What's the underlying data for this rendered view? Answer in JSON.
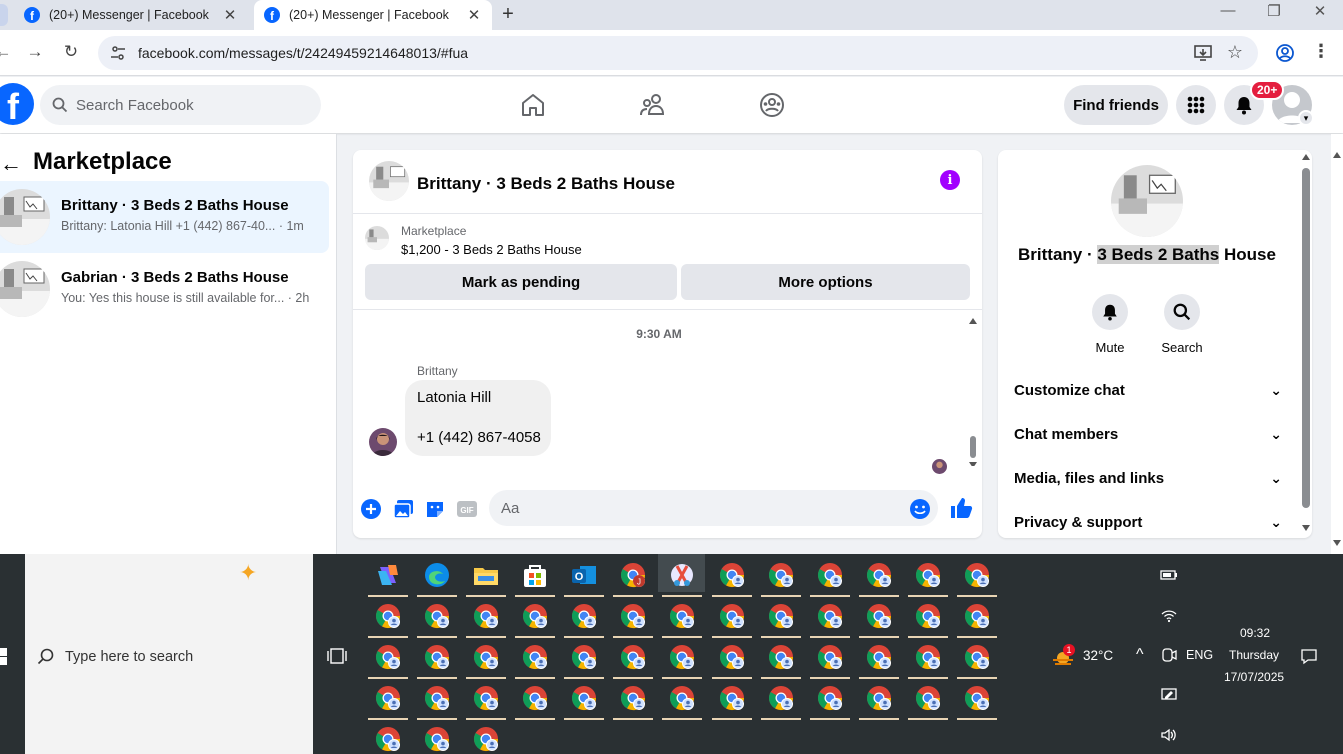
{
  "browser": {
    "tabs": [
      {
        "title": "(20+) Messenger | Facebook",
        "active": false
      },
      {
        "title": "(20+) Messenger | Facebook",
        "active": true
      }
    ],
    "new_tab_label": "+",
    "url": "facebook.com/messages/t/24249459214648013/#fua"
  },
  "fb": {
    "logo_letter": "f",
    "search_placeholder": "Search Facebook",
    "find_friends_label": "Find friends",
    "notifications_badge": "20+",
    "brand_color": "#0866ff"
  },
  "left": {
    "title": "Marketplace",
    "back_icon": "arrow-left-icon",
    "conversations": [
      {
        "name": "Brittany · 3 Beds 2 Baths House",
        "preview": "Brittany: Latonia Hill +1 (442) 867-40...",
        "time": "· 1m",
        "selected": true
      },
      {
        "name": "Gabrian · 3 Beds 2 Baths House",
        "preview": "You: Yes this house is still available for...",
        "time": "· 2h",
        "selected": false
      }
    ]
  },
  "chat": {
    "title": "Brittany · 3 Beds 2 Baths House",
    "info_glyph": "i",
    "listing_category": "Marketplace",
    "listing_price_title": "$1,200 - 3 Beds 2 Baths House",
    "mark_pending_label": "Mark as pending",
    "more_options_label": "More options",
    "timestamp": "9:30 AM",
    "sender": "Brittany",
    "message_line1": "Latonia Hill",
    "message_line2": "+1 (442) 867-4058",
    "composer_placeholder": "Aa",
    "accent_color": "#0866ff"
  },
  "info_panel": {
    "name_prefix": "Brittany · ",
    "name_highlight": "3 Beds 2 Baths",
    "name_suffix": " House",
    "actions": [
      {
        "label": "Mute",
        "icon": "bell-icon"
      },
      {
        "label": "Search",
        "icon": "search-icon"
      }
    ],
    "sections": [
      "Customize chat",
      "Chat members",
      "Media, files and links",
      "Privacy & support"
    ]
  },
  "taskbar": {
    "search_placeholder": "Type here to search",
    "weather_temp": "32°C",
    "language": "ENG",
    "time": "09:32",
    "day": "Thursday",
    "date": "17/07/2025",
    "weather_badge": "1",
    "outlook_letter": "O",
    "chrome_profile_letter": "J"
  }
}
